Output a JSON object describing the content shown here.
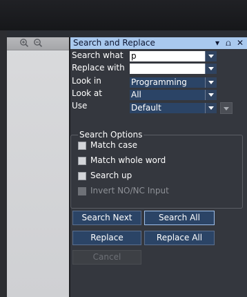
{
  "dialog": {
    "title": "Search and Replace",
    "titlebar_icons": {
      "dropdown": "▾",
      "pin": "⩍",
      "close": "✕"
    }
  },
  "form": {
    "search_what": {
      "label": "Search what",
      "value": "p"
    },
    "replace_with": {
      "label": "Replace with",
      "value": ""
    },
    "look_in": {
      "label": "Look in",
      "value": "Programming"
    },
    "look_at": {
      "label": "Look at",
      "value": "All"
    },
    "use": {
      "label": "Use",
      "value": "Default"
    }
  },
  "search_options": {
    "legend": "Search Options",
    "items": [
      {
        "label": "Match case",
        "checked": false,
        "enabled": true
      },
      {
        "label": "Match whole word",
        "checked": false,
        "enabled": true
      },
      {
        "label": "Search up",
        "checked": false,
        "enabled": true
      },
      {
        "label": "Invert NO/NC Input",
        "checked": false,
        "enabled": false
      }
    ]
  },
  "buttons": {
    "search_next": "Search Next",
    "search_all": "Search All",
    "replace": "Replace",
    "replace_all": "Replace All",
    "cancel": "Cancel"
  },
  "colors": {
    "titlebar": "#a9c9ee",
    "panel_bg": "#34373e",
    "button_bg": "#2b4466",
    "focus_border": "#9fc0ea"
  }
}
